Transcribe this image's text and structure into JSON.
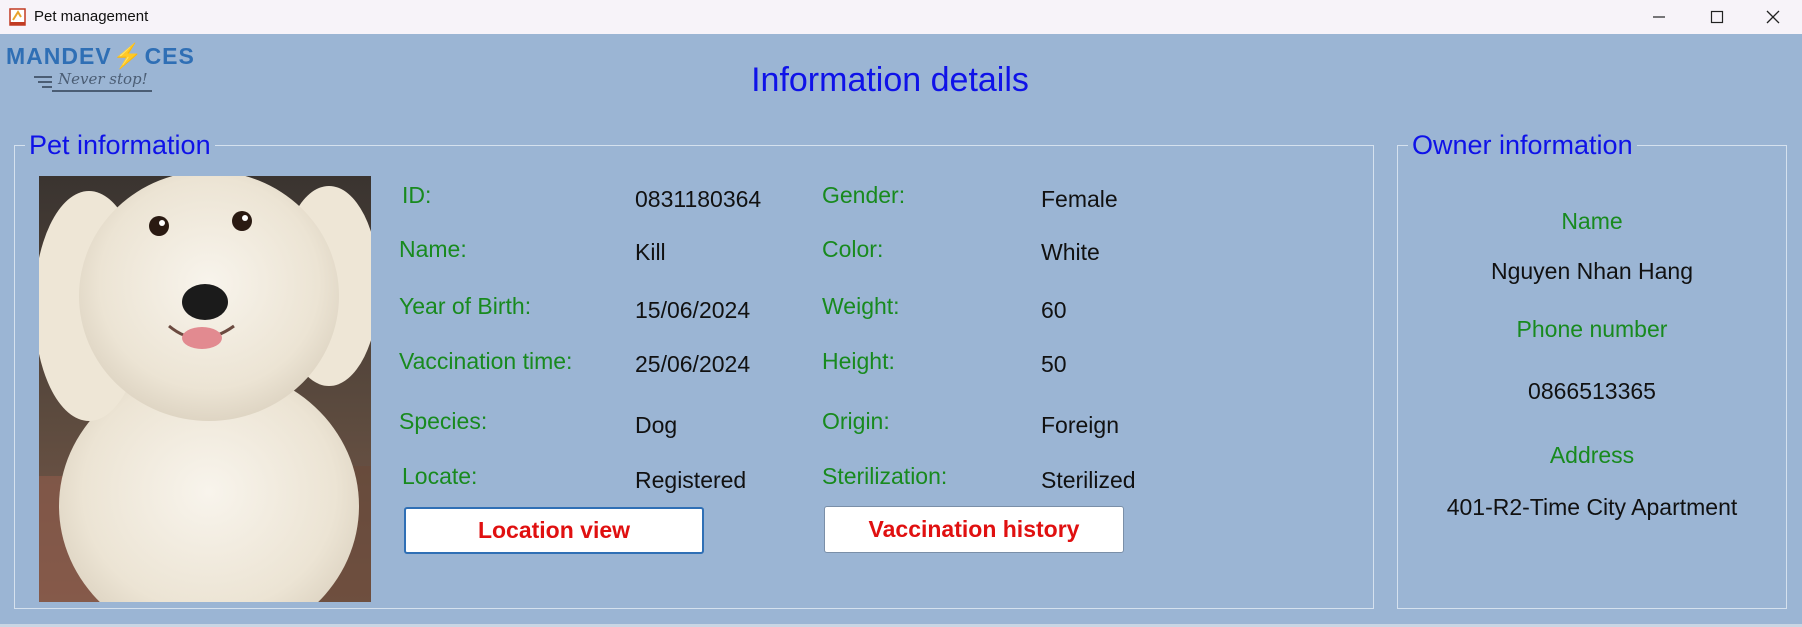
{
  "window": {
    "title": "Pet management",
    "controls": {
      "minimize": "minimize-icon",
      "maximize": "maximize-icon",
      "close": "close-icon"
    }
  },
  "logo": {
    "brand_part1": "MANDEV",
    "brand_part2": "CES",
    "tagline": "Never stop!"
  },
  "page_title": "Information details",
  "pet": {
    "legend": "Pet information",
    "fields": {
      "id": {
        "label": "ID:",
        "value": "0831180364"
      },
      "name": {
        "label": "Name:",
        "value": "Kill"
      },
      "year_of_birth": {
        "label": "Year of Birth:",
        "value": "15/06/2024"
      },
      "vaccination_time": {
        "label": "Vaccination time:",
        "value": "25/06/2024"
      },
      "species": {
        "label": "Species:",
        "value": "Dog"
      },
      "locate": {
        "label": "Locate:",
        "value": "Registered"
      },
      "gender": {
        "label": "Gender:",
        "value": "Female"
      },
      "color": {
        "label": "Color:",
        "value": "White"
      },
      "weight": {
        "label": "Weight:",
        "value": "60"
      },
      "height": {
        "label": "Height:",
        "value": "50"
      },
      "origin": {
        "label": "Origin:",
        "value": "Foreign"
      },
      "sterilization": {
        "label": "Sterilization:",
        "value": "Sterilized"
      }
    },
    "buttons": {
      "location_view": "Location view",
      "vaccination_history": "Vaccination history"
    }
  },
  "owner": {
    "legend": "Owner information",
    "name_label": "Name",
    "name_value": "Nguyen Nhan Hang",
    "phone_label": "Phone number",
    "phone_value": "0866513365",
    "address_label": "Address",
    "address_value": "401-R2-Time City Apartment"
  },
  "colors": {
    "background": "#9bb5d4",
    "heading_blue": "#0f12e8",
    "label_green": "#188a1e",
    "button_text_red": "#e01010"
  }
}
